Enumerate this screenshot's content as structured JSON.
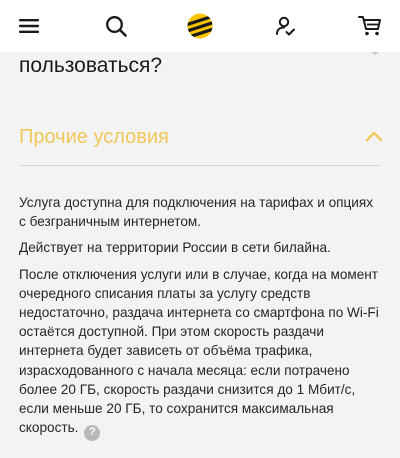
{
  "header": {
    "menu_icon": "hamburger-menu-icon",
    "search_icon": "search-icon",
    "logo_icon": "beeline-logo-icon",
    "profile_icon": "user-profile-icon",
    "cart_icon": "shopping-cart-icon"
  },
  "faq": {
    "previous_question_tail": "пользоваться?",
    "section_title": "Прочие условия",
    "paragraphs": {
      "p1": "Услуга доступна для подключения на тарифах и опциях с безграничным интернетом.",
      "p2": "Действует на территории России в сети билайна.",
      "p3": "После отключения услуги или в случае, когда на момент очередного списания платы за услугу средств недостаточно, раздача интернета со смартфона по Wi-Fi остаётся доступной. При этом скорость раздачи интернета будет зависеть от объёма трафика, израсходованного с начала месяца: если потрачено более 20 ГБ, скорость раздачи снизится до 1 Мбит/с, если меньше 20 ГБ, то сохранится максимальная скорость."
    },
    "help_badge": "?"
  },
  "colors": {
    "accent": "#f0c75a",
    "logo_yellow": "#fdc500",
    "logo_black": "#1a1a1a",
    "background": "#f3f3f3",
    "header_bg": "#ffffff"
  }
}
